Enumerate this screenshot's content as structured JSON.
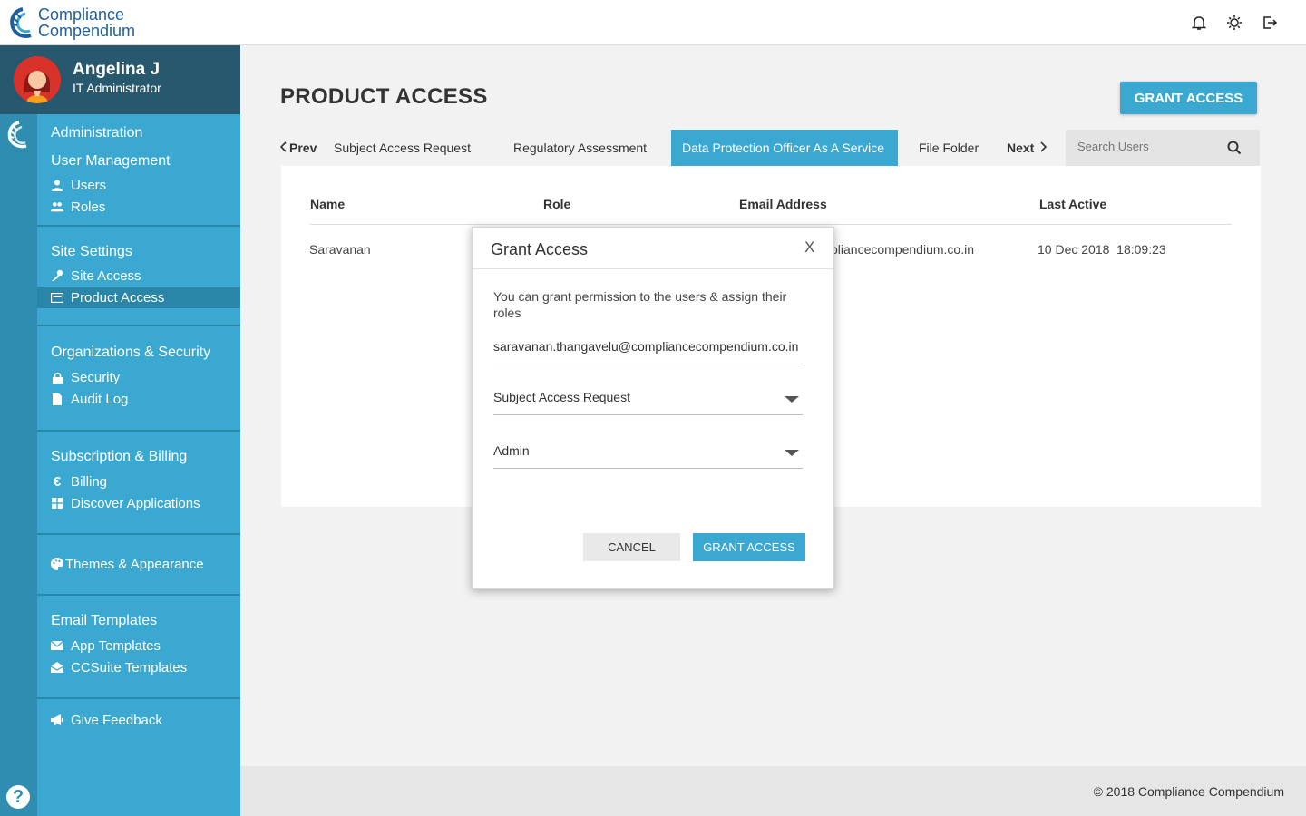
{
  "app": {
    "logo_line1": "Compliance",
    "logo_line2": "Compendium"
  },
  "profile": {
    "name": "Angelina J",
    "role": "IT Administrator"
  },
  "sidebar": {
    "administration": "Administration",
    "user_management": "User Management",
    "users": "Users",
    "roles": "Roles",
    "site_settings": "Site Settings",
    "site_access": "Site Access",
    "product_access": "Product Access",
    "org_security": "Organizations & Security",
    "security": "Security",
    "audit_log": "Audit Log",
    "subscription_billing": "Subscription & Billing",
    "billing": "Billing",
    "discover_apps": "Discover Applications",
    "themes": "Themes & Appearance",
    "email_templates": "Email Templates",
    "app_templates": "App Templates",
    "ccsuite_templates": "CCSuite Templates",
    "feedback": "Give Feedback"
  },
  "main": {
    "title": "PRODUCT ACCESS",
    "grant_button": "GRANT ACCESS",
    "tabs": {
      "prev": "Prev",
      "sar": "Subject Access Request",
      "reg": "Regulatory Assessment",
      "dpo": "Data Protection Officer As A Service",
      "file": "File Folder",
      "next": "Next"
    },
    "search_placeholder": "Search Users",
    "table": {
      "headers": [
        "Name",
        "Role",
        "Email Address",
        "Last Active"
      ],
      "rows": [
        {
          "name": "Saravanan",
          "email": "pliancecompendium.co.in",
          "last_active": "10 Dec 2018  18:09:23"
        }
      ]
    }
  },
  "modal": {
    "title": "Grant Access",
    "close": "X",
    "description": "You can grant permission to the users & assign their roles",
    "email": "saravanan.thangavelu@compliancecompendium.co.in",
    "product": "Subject Access Request",
    "role": "Admin",
    "cancel": "CANCEL",
    "grant": "GRANT ACCESS"
  },
  "footer": {
    "copyright": "© 2018 Compliance Compendium"
  },
  "colors": {
    "accent": "#3aa8d0",
    "profile_bg": "#28586e",
    "rail": "#2e8db0"
  }
}
